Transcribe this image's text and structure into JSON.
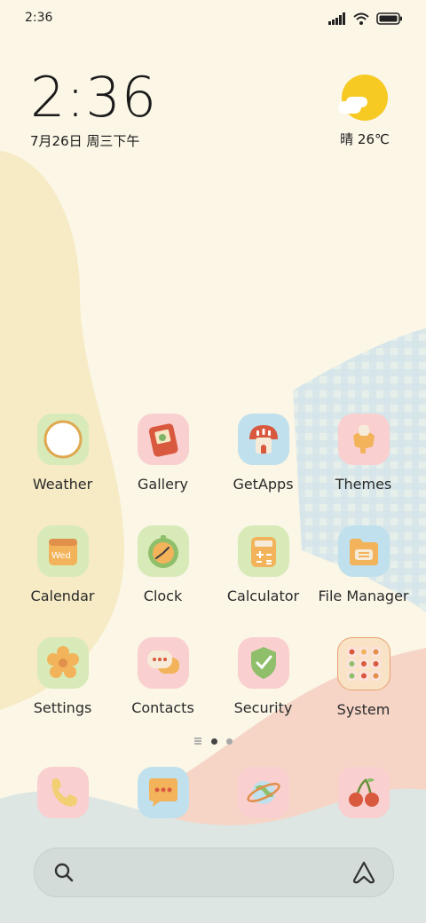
{
  "status_bar": {
    "time": "2:36"
  },
  "clock_widget": {
    "time": "2:36",
    "date": "7月26日 周三下午"
  },
  "weather_widget": {
    "text": "晴 26℃"
  },
  "apps": [
    {
      "label": "Weather",
      "icon": "weather-icon",
      "tile_color": "#d8eab8"
    },
    {
      "label": "Gallery",
      "icon": "gallery-icon",
      "tile_color": "#f9cfcf"
    },
    {
      "label": "GetApps",
      "icon": "getapps-icon",
      "tile_color": "#bfe0ec"
    },
    {
      "label": "Themes",
      "icon": "themes-icon",
      "tile_color": "#f9cfcf"
    },
    {
      "label": "Calendar",
      "icon": "calendar-icon",
      "tile_color": "#d8eab8",
      "icon_text": "Wed"
    },
    {
      "label": "Clock",
      "icon": "clock-icon",
      "tile_color": "#d8eab8"
    },
    {
      "label": "Calculator",
      "icon": "calculator-icon",
      "tile_color": "#d8eab8"
    },
    {
      "label": "File Manager",
      "icon": "file-manager-icon",
      "tile_color": "#bfe0ec"
    },
    {
      "label": "Settings",
      "icon": "settings-icon",
      "tile_color": "#d8eab8"
    },
    {
      "label": "Contacts",
      "icon": "contacts-icon",
      "tile_color": "#f9cfcf"
    },
    {
      "label": "Security",
      "icon": "security-icon",
      "tile_color": "#f9cfcf"
    },
    {
      "label": "System",
      "icon": "system-icon",
      "tile_color": "#f9e3c7"
    }
  ],
  "page_indicator": {
    "pages": 2,
    "current": 1
  },
  "dock": [
    {
      "icon": "phone-icon",
      "tile_color": "#f9cfcf"
    },
    {
      "icon": "messages-icon",
      "tile_color": "#bfe0ec"
    },
    {
      "icon": "browser-icon",
      "tile_color": "#f9cfcf"
    },
    {
      "icon": "cherry-icon",
      "tile_color": "#f9cfcf"
    }
  ],
  "search": {
    "placeholder": ""
  },
  "colors": {
    "background": "#fbf6e6",
    "accent_yellow": "#f6c923"
  }
}
